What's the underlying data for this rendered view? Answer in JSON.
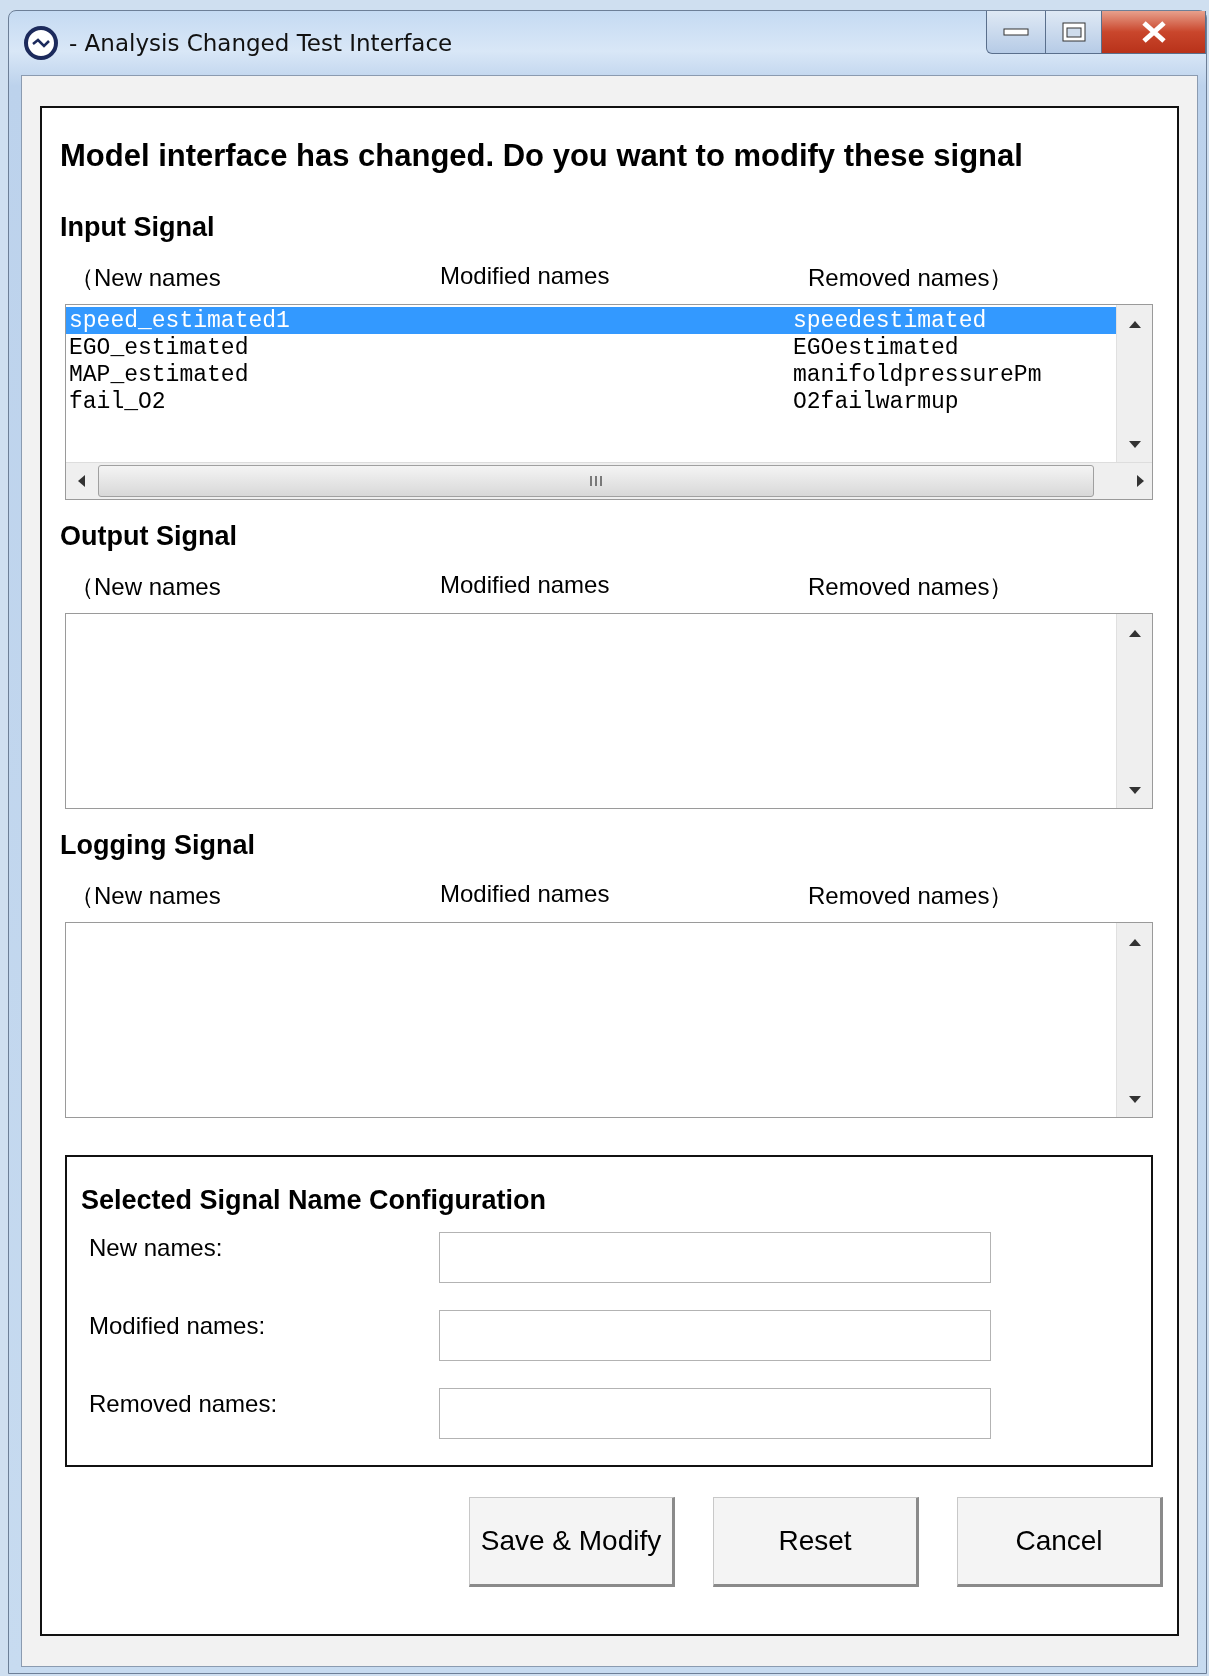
{
  "window": {
    "title": "- Analysis Changed Test Interface"
  },
  "heading": "Model interface has changed. Do you want to modify these signal",
  "sections": [
    {
      "title": "Input Signal",
      "columns": [
        "（New names",
        "Modified names",
        "Removed names）"
      ],
      "horizontal_scrollbar": true,
      "rows": [
        {
          "new_name": "speed_estimated1",
          "removed_name": "speedestimated",
          "selected": true
        },
        {
          "new_name": "EGO_estimated",
          "removed_name": "EGOestimated",
          "selected": false
        },
        {
          "new_name": "MAP_estimated",
          "removed_name": "manifoldpressurePm",
          "selected": false
        },
        {
          "new_name": "fail_O2",
          "removed_name": "O2failwarmup",
          "selected": false
        }
      ]
    },
    {
      "title": "Output Signal",
      "columns": [
        "（New names",
        "Modified names",
        "Removed names）"
      ],
      "horizontal_scrollbar": false
    },
    {
      "title": "Logging Signal",
      "columns": [
        "（New names",
        "Modified names",
        "Removed names）"
      ],
      "horizontal_scrollbar": false
    }
  ],
  "config": {
    "title": "Selected Signal Name Configuration",
    "fields": [
      {
        "label": "New names:"
      },
      {
        "label": "Modified names:"
      },
      {
        "label": "Removed names:"
      }
    ]
  },
  "buttons": [
    "Save & Modify",
    "Reset",
    "Cancel"
  ]
}
